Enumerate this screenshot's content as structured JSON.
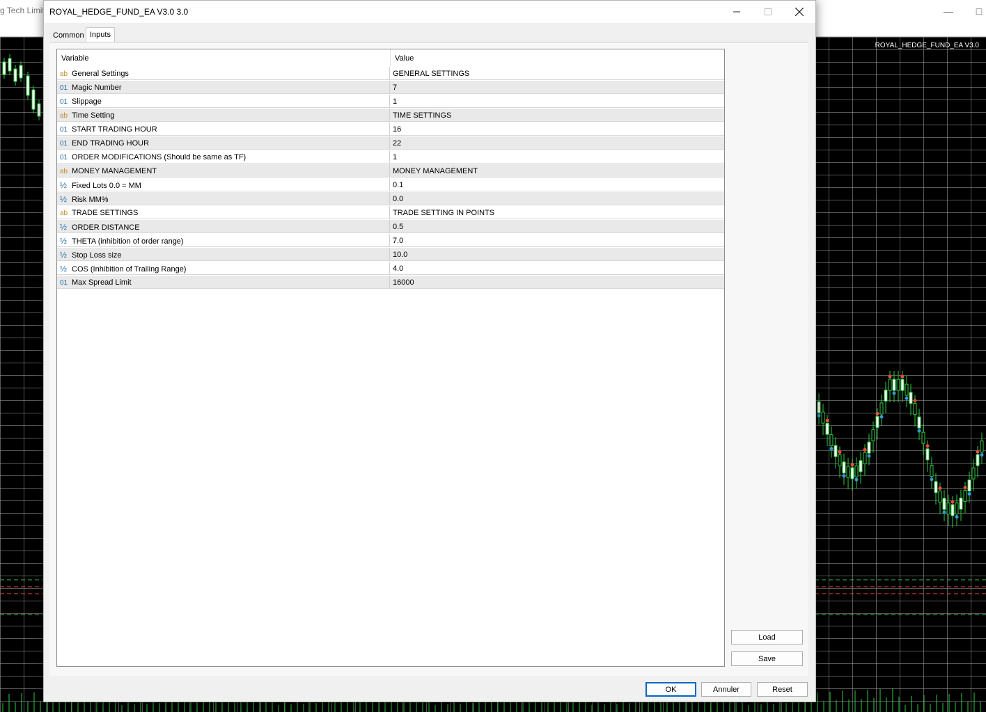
{
  "background": {
    "partial_title": "g Tech Limite",
    "chart_label": "ROYAL_HEDGE_FUND_EA V3.0"
  },
  "dialog": {
    "title": "ROYAL_HEDGE_FUND_EA V3.0 3.0",
    "tabs": [
      {
        "label": "Common",
        "active": false
      },
      {
        "label": "Inputs",
        "active": true
      }
    ],
    "table": {
      "headers": {
        "variable": "Variable",
        "value": "Value"
      },
      "rows": [
        {
          "type": "ab",
          "variable": "General Settings",
          "value": "GENERAL SETTINGS"
        },
        {
          "type": "01",
          "variable": "Magic Number",
          "value": "7"
        },
        {
          "type": "01",
          "variable": "Slippage",
          "value": "1"
        },
        {
          "type": "ab",
          "variable": "Time Setting",
          "value": "TIME SETTINGS"
        },
        {
          "type": "01",
          "variable": "START TRADING HOUR",
          "value": "16"
        },
        {
          "type": "01",
          "variable": "END TRADING HOUR",
          "value": "22"
        },
        {
          "type": "01",
          "variable": "ORDER MODIFICATIONS (Should be same as TF)",
          "value": "1"
        },
        {
          "type": "ab",
          "variable": "MONEY MANAGEMENT",
          "value": "MONEY MANAGEMENT"
        },
        {
          "type": "½",
          "variable": "Fixed Lots 0.0 = MM",
          "value": "0.1"
        },
        {
          "type": "½",
          "variable": "Risk MM%",
          "value": "0.0"
        },
        {
          "type": "ab",
          "variable": "TRADE SETTINGS",
          "value": "TRADE SETTING IN POINTS"
        },
        {
          "type": "½",
          "variable": "ORDER DISTANCE",
          "value": "0.5"
        },
        {
          "type": "½",
          "variable": "THETA (inhibition of order range)",
          "value": "7.0"
        },
        {
          "type": "½",
          "variable": "Stop Loss size",
          "value": "10.0"
        },
        {
          "type": "½",
          "variable": "COS (Inhibition of Trailing Range)",
          "value": "4.0"
        },
        {
          "type": "01",
          "variable": "Max Spread Limit",
          "value": "16000"
        }
      ]
    },
    "side_buttons": {
      "load": "Load",
      "save": "Save"
    },
    "footer_buttons": {
      "ok": "OK",
      "cancel": "Annuler",
      "reset": "Reset"
    }
  }
}
